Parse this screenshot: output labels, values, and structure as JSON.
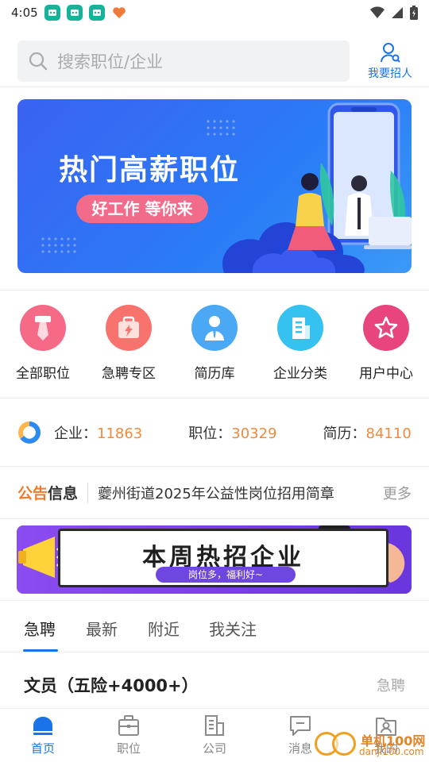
{
  "status_bar": {
    "time": "4:05"
  },
  "header": {
    "search_placeholder": "搜索职位/企业",
    "recruit_label": "我要招人"
  },
  "banner": {
    "title": "热门高薪职位",
    "subtitle": "好工作 等你来"
  },
  "categories": [
    {
      "label": "全部职位",
      "icon": "tie-icon",
      "color": "#f56a86"
    },
    {
      "label": "急聘专区",
      "icon": "briefcase-lightning-icon",
      "color": "#f8736e"
    },
    {
      "label": "简历库",
      "icon": "person-icon",
      "color": "#4aa8f5"
    },
    {
      "label": "企业分类",
      "icon": "building-icon",
      "color": "#36c2f0"
    },
    {
      "label": "用户中心",
      "icon": "star-icon",
      "color": "#e8457e"
    }
  ],
  "stats": {
    "company_label": "企业：",
    "company_value": "11863",
    "job_label": "职位：",
    "job_value": "30329",
    "resume_label": "简历：",
    "resume_value": "84110"
  },
  "notice": {
    "tag_part1": "公告",
    "tag_part2": "信息",
    "text": "夔州街道2025年公益性岗位招用简章",
    "more": "更多"
  },
  "promo": {
    "title": "本周热招企业",
    "subtitle": "岗位多，福利好~"
  },
  "tabs": [
    "急聘",
    "最新",
    "附近",
    "我关注"
  ],
  "job": {
    "title": "文员（五险+4000+）",
    "badge": "急聘"
  },
  "bottom_nav": [
    {
      "label": "首页",
      "icon": "home-icon"
    },
    {
      "label": "职位",
      "icon": "briefcase-icon"
    },
    {
      "label": "公司",
      "icon": "building-icon"
    },
    {
      "label": "消息",
      "icon": "message-icon"
    },
    {
      "label": "我的",
      "icon": "profile-icon"
    }
  ],
  "watermark": {
    "line1": "单机100网",
    "line2": "danji100.com"
  },
  "colors": {
    "accent": "#1a73e8",
    "number": "#f08a3c",
    "notice_orange": "#f07a2a"
  }
}
